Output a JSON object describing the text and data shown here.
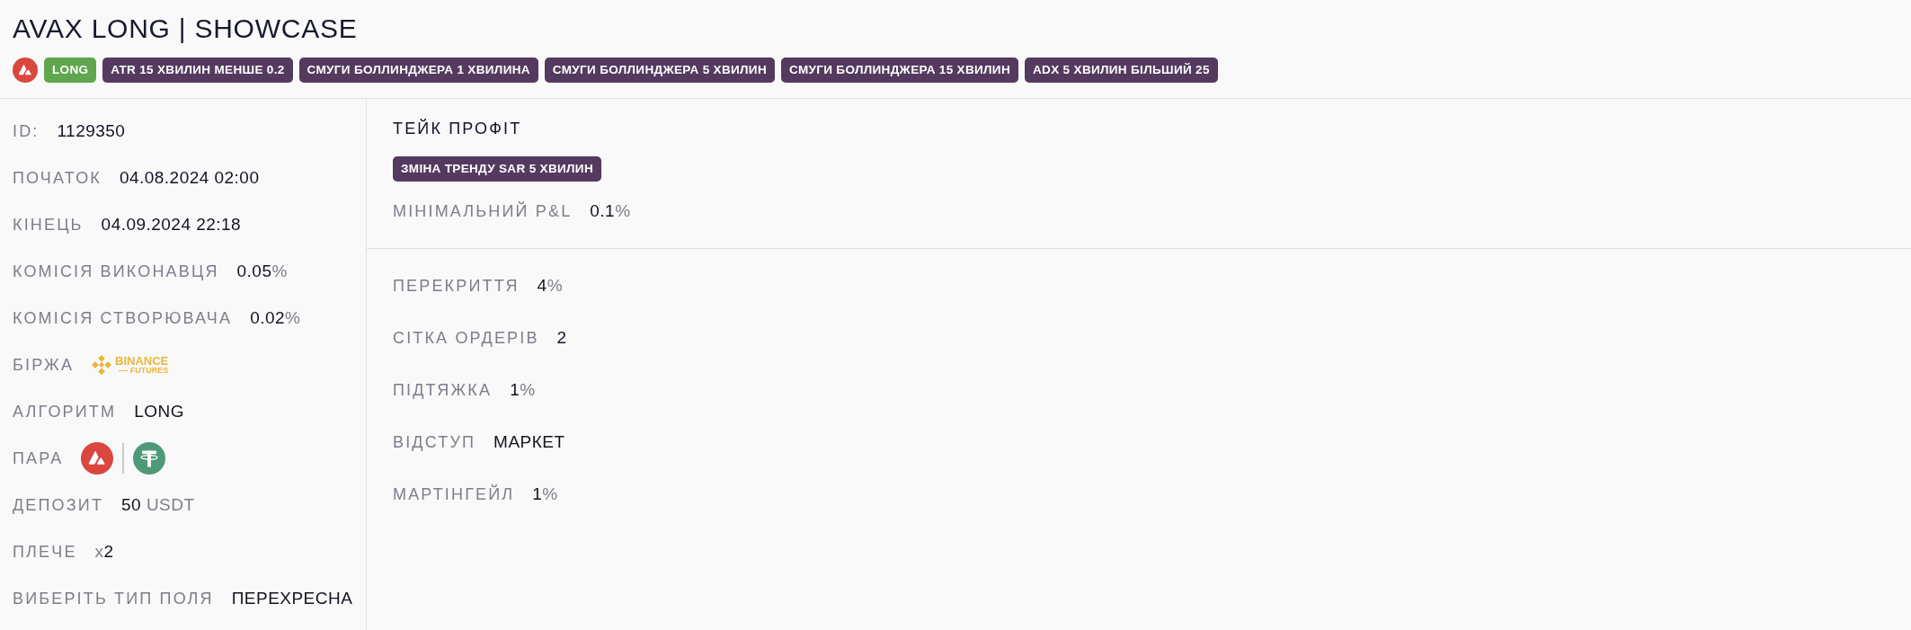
{
  "title": "AVAX LONG | SHOWCASE",
  "tags": [
    {
      "label": "LONG",
      "color": "#5fa64e"
    },
    {
      "label": "ATR 15 ХВИЛИН МЕНШЕ 0.2",
      "color": "#553a5f"
    },
    {
      "label": "СМУГИ БОЛЛИНДЖЕРА 1 ХВИЛИНА",
      "color": "#553a5f"
    },
    {
      "label": "СМУГИ БОЛЛИНДЖЕРА 5 ХВИЛИН",
      "color": "#553a5f"
    },
    {
      "label": "СМУГИ БОЛЛИНДЖЕРА 15 ХВИЛИН",
      "color": "#553a5f"
    },
    {
      "label": "ADX 5 ХВИЛИН БІЛЬШИЙ 25",
      "color": "#553a5f"
    }
  ],
  "details": [
    {
      "kind": "text",
      "label": "ID:",
      "value": "1129350"
    },
    {
      "kind": "text",
      "label": "ПОЧАТОК",
      "value": "04.08.2024 02:00"
    },
    {
      "kind": "text",
      "label": "КІНЕЦЬ",
      "value": "04.09.2024 22:18"
    },
    {
      "kind": "text",
      "label": "КОМІСІЯ ВИКОНАВЦЯ",
      "value": "0.05",
      "unit": "%"
    },
    {
      "kind": "text",
      "label": "КОМІСІЯ СТВОРЮВАЧА",
      "value": "0.02",
      "unit": "%"
    },
    {
      "kind": "exchange",
      "label": "БІРЖА",
      "logo_lines": [
        "BINANCE",
        "FUTURES"
      ]
    },
    {
      "kind": "text",
      "label": "АЛГОРИТМ",
      "value": "LONG"
    },
    {
      "kind": "pair",
      "label": "ПАРА"
    },
    {
      "kind": "text",
      "label": "ДЕПОЗИТ",
      "value": "50",
      "unit": "USDT"
    },
    {
      "kind": "text",
      "label": "ПЛЕЧЕ",
      "prefix": "x",
      "value": "2"
    },
    {
      "kind": "text",
      "label": "ВИБЕРІТЬ ТИП ПОЛЯ",
      "value": "ПЕРЕХРЕСНА"
    }
  ],
  "take_profit": {
    "title": "ТЕЙК ПРОФІТ",
    "tags": [
      {
        "label": "ЗМІНА ТРЕНДУ SAR 5 ХВИЛИН",
        "color": "#553a5f"
      }
    ],
    "min_pnl": {
      "label": "МІНІМАЛЬНИЙ P&L",
      "value": "0.1",
      "unit": "%"
    }
  },
  "settings": [
    {
      "label": "ПЕРЕКРИТТЯ",
      "value": "4",
      "unit": "%"
    },
    {
      "label": "СІТКА ОРДЕРІВ",
      "value": "2"
    },
    {
      "label": "ПІДТЯЖКА",
      "value": "1",
      "unit": "%"
    },
    {
      "label": "ВІДСТУП",
      "value": "МАРКЕТ"
    },
    {
      "label": "МАРТІНГЕЙЛ",
      "value": "1",
      "unit": "%"
    }
  ]
}
